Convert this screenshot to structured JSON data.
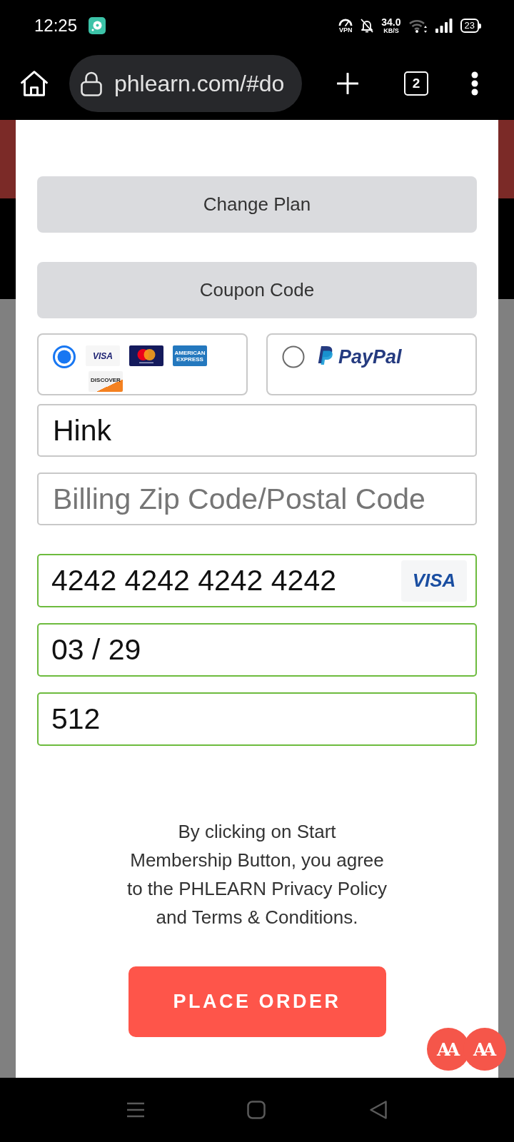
{
  "status_bar": {
    "time": "12:25",
    "vpn_label": "VPN",
    "network_speed": "34.0",
    "speed_unit": "KB/S",
    "battery": "23"
  },
  "browser_bar": {
    "url": "phlearn.com/#do",
    "tab_count": "2"
  },
  "checkout": {
    "buttons": [
      {
        "label": "Change Plan"
      },
      {
        "label": "Coupon Code"
      }
    ],
    "payment_methods": [
      {
        "kind": "card",
        "selected": true,
        "logos": [
          {
            "kind": "visa",
            "label": "VISA"
          },
          {
            "kind": "mastercard"
          },
          {
            "kind": "amex",
            "label": "AMERICAN EXPRESS"
          },
          {
            "kind": "discover",
            "label": "DISCOVER"
          }
        ]
      },
      {
        "kind": "paypal",
        "selected": false,
        "label": "PayPal"
      }
    ],
    "fields": [
      {
        "kind": "text",
        "value": "Hink",
        "valid": false
      },
      {
        "kind": "text",
        "placeholder": "Billing Zip Code/Postal Code",
        "valid": false
      },
      {
        "kind": "card",
        "value": "4242 4242 4242 4242",
        "valid": true,
        "brand_badge": "VISA"
      },
      {
        "kind": "card",
        "value": "03 / 29",
        "valid": true
      },
      {
        "kind": "card",
        "value": "512",
        "valid": true
      }
    ],
    "terms": "By clicking on Start Membership Button, you agree to the PHLEARN Privacy Policy and Terms & Conditions.",
    "submit_button": "PLACE ORDER"
  },
  "font_size_buttons": [
    {
      "label": "AA"
    },
    {
      "label": "AA"
    }
  ]
}
